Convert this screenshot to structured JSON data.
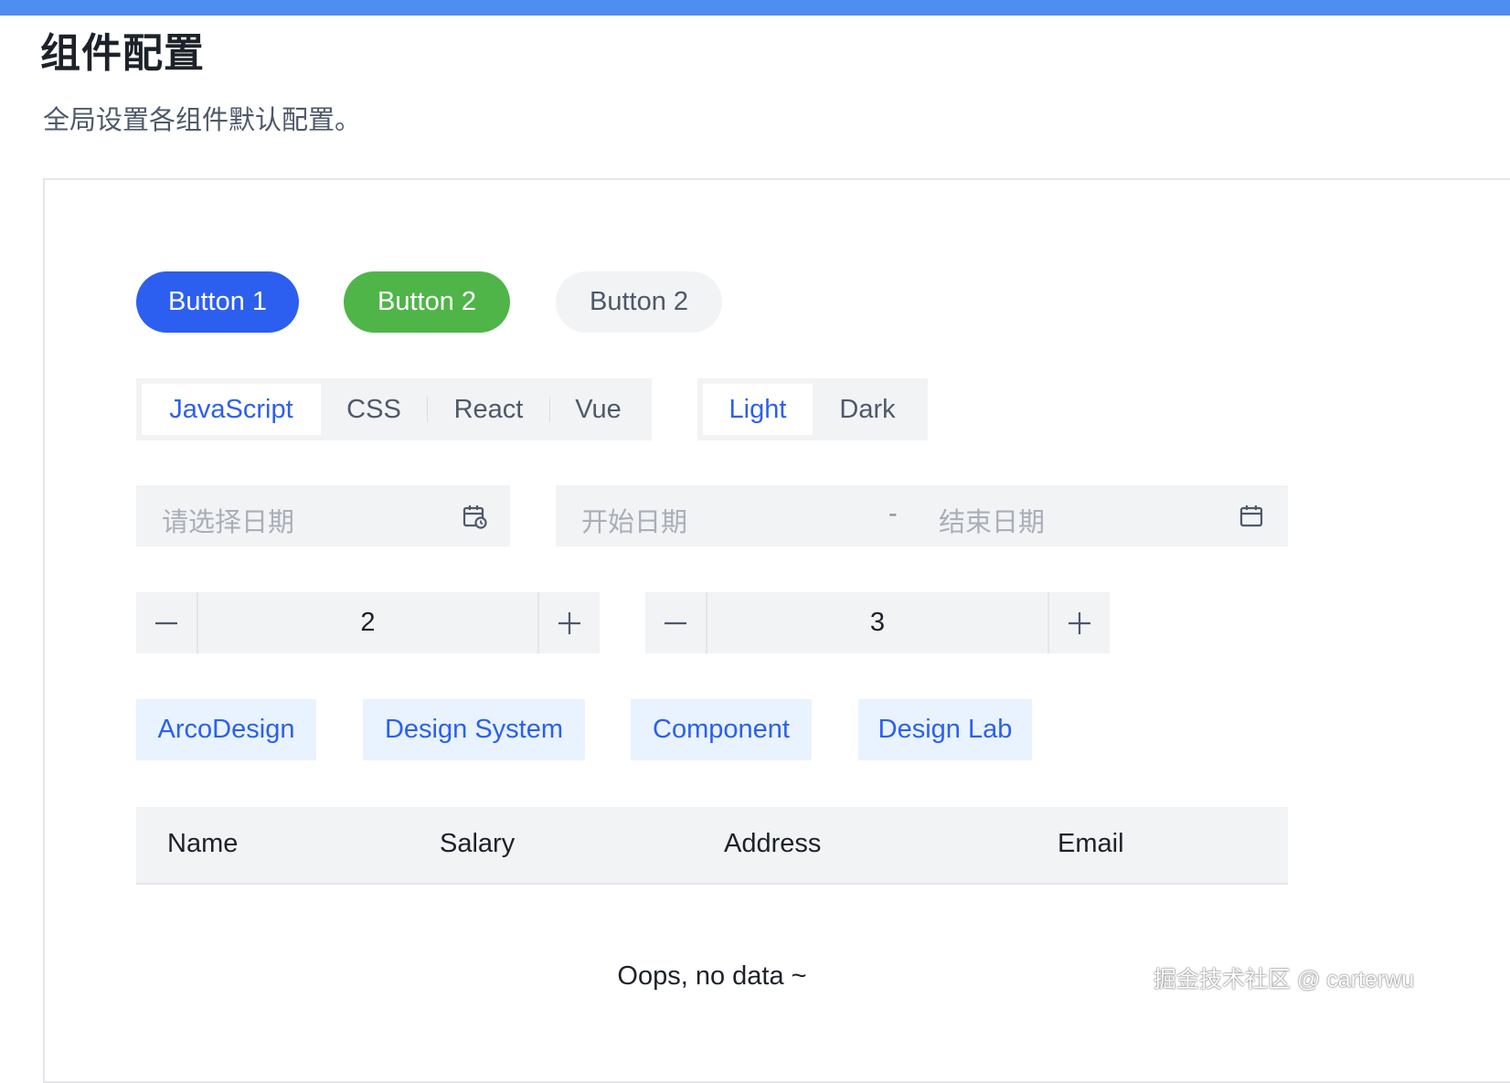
{
  "header": {
    "title": "组件配置",
    "description": "全局设置各组件默认配置。"
  },
  "buttons": {
    "primary": "Button 1",
    "success": "Button 2",
    "secondary": "Button 2"
  },
  "radio_groups": {
    "language": {
      "options": [
        "JavaScript",
        "CSS",
        "React",
        "Vue"
      ],
      "selected": "JavaScript"
    },
    "theme": {
      "options": [
        "Light",
        "Dark"
      ],
      "selected": "Light"
    }
  },
  "date_picker": {
    "placeholder": "请选择日期"
  },
  "range_picker": {
    "start_placeholder": "开始日期",
    "separator": "-",
    "end_placeholder": "结束日期"
  },
  "steppers": [
    {
      "value": "2"
    },
    {
      "value": "3"
    }
  ],
  "tags": [
    "ArcoDesign",
    "Design System",
    "Component",
    "Design Lab"
  ],
  "table": {
    "columns": [
      "Name",
      "Salary",
      "Address",
      "Email"
    ],
    "empty_text": "Oops, no data ~"
  },
  "watermark": "掘金技术社区 @ carterwu",
  "colors": {
    "primary": "#2c5ff0",
    "success": "#4fb548",
    "topbar": "#4d8ef0",
    "fill": "#f2f3f5",
    "tag_bg": "#e8f3ff"
  },
  "icons": [
    "calendar-clock-icon",
    "calendar-icon",
    "minus-icon",
    "plus-icon"
  ]
}
